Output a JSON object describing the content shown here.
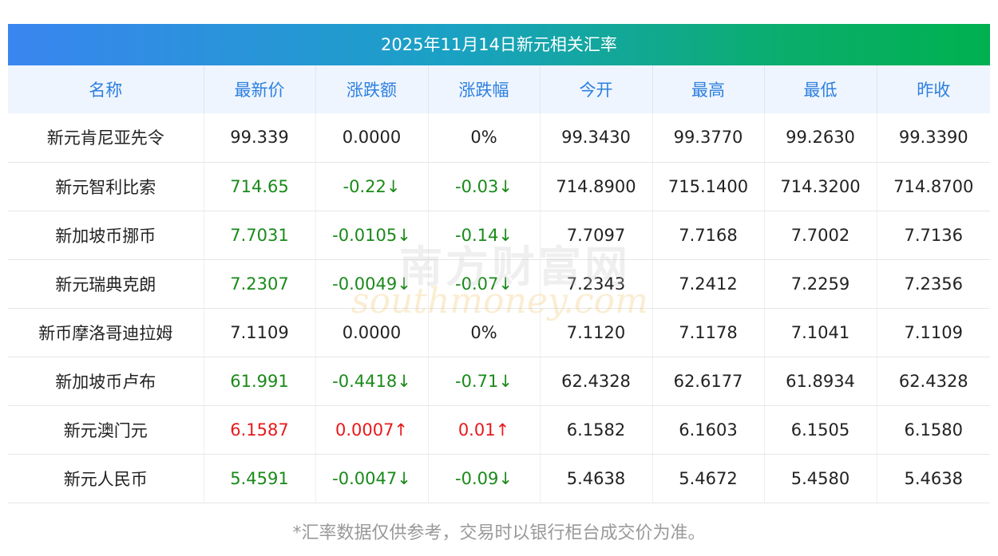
{
  "title": "2025年11月14日新元相关汇率",
  "headers": [
    "名称",
    "最新价",
    "涨跌额",
    "涨跌幅",
    "今开",
    "最高",
    "最低",
    "昨收"
  ],
  "rows": [
    {
      "name": "新元肯尼亚先令",
      "latest": "99.339",
      "change": "0.0000",
      "pct": "0%",
      "open": "99.3430",
      "high": "99.3770",
      "low": "99.2630",
      "prev": "99.3390",
      "trend": "flat"
    },
    {
      "name": "新元智利比索",
      "latest": "714.65",
      "change": "-0.22↓",
      "pct": "-0.03↓",
      "open": "714.8900",
      "high": "715.1400",
      "low": "714.3200",
      "prev": "714.8700",
      "trend": "down"
    },
    {
      "name": "新加坡币挪币",
      "latest": "7.7031",
      "change": "-0.0105↓",
      "pct": "-0.14↓",
      "open": "7.7097",
      "high": "7.7168",
      "low": "7.7002",
      "prev": "7.7136",
      "trend": "down"
    },
    {
      "name": "新元瑞典克朗",
      "latest": "7.2307",
      "change": "-0.0049↓",
      "pct": "-0.07↓",
      "open": "7.2343",
      "high": "7.2412",
      "low": "7.2259",
      "prev": "7.2356",
      "trend": "down"
    },
    {
      "name": "新币摩洛哥迪拉姆",
      "latest": "7.1109",
      "change": "0.0000",
      "pct": "0%",
      "open": "7.1120",
      "high": "7.1178",
      "low": "7.1041",
      "prev": "7.1109",
      "trend": "flat"
    },
    {
      "name": "新加坡币卢布",
      "latest": "61.991",
      "change": "-0.4418↓",
      "pct": "-0.71↓",
      "open": "62.4328",
      "high": "62.6177",
      "low": "61.8934",
      "prev": "62.4328",
      "trend": "down"
    },
    {
      "name": "新元澳门元",
      "latest": "6.1587",
      "change": "0.0007↑",
      "pct": "0.01↑",
      "open": "6.1582",
      "high": "6.1603",
      "low": "6.1505",
      "prev": "6.1580",
      "trend": "up"
    },
    {
      "name": "新元人民币",
      "latest": "5.4591",
      "change": "-0.0047↓",
      "pct": "-0.09↓",
      "open": "5.4638",
      "high": "5.4672",
      "low": "5.4580",
      "prev": "5.4638",
      "trend": "down"
    }
  ],
  "footnote": "*汇率数据仅供参考，交易时以银行柜台成交价为准。",
  "watermark": {
    "cn": "南方财富网",
    "en": "southmoney.com"
  },
  "colors": {
    "up": "#e8191c",
    "down": "#1a8a1a",
    "header_text": "#2d7fe0"
  }
}
